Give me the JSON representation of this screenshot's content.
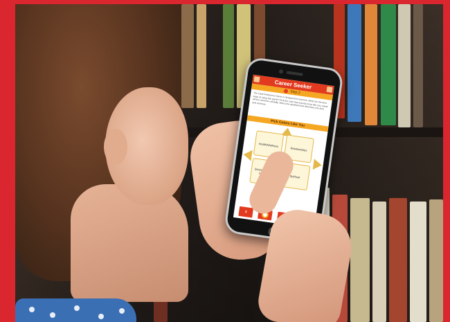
{
  "app": {
    "title": "Career Seeker",
    "step_label": "Step 2",
    "intro_text": "The Card Preference Game is designed for learners. What are the best ways of using this game? Pick the color that sounds more like you. Read all four sections carefully. Select the quadrant that describes you best and continue.",
    "pick_label": "Pick Colors Like You",
    "quadrants": [
      "Health/Wellness",
      "Relationships",
      "Business/Career Financial",
      "Spiritual"
    ],
    "nav": {
      "back_label": "‹",
      "help_label": "?",
      "next_label": "›"
    }
  },
  "colors": {
    "frame": "#d9262f",
    "titlebar": "#e23a1f",
    "accent": "#f5a623",
    "quad_border": "#e4b84a"
  }
}
